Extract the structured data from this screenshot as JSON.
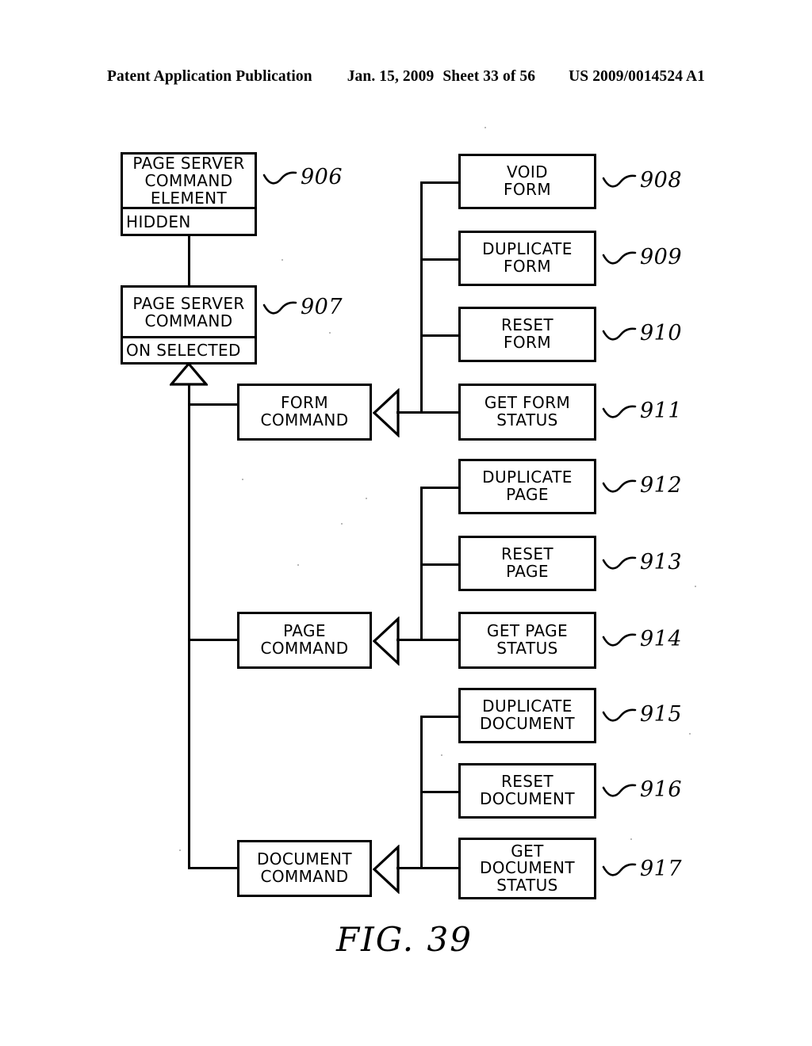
{
  "header": {
    "title": "Patent Application Publication",
    "date": "Jan. 15, 2009",
    "sheet": "Sheet 33 of 56",
    "patent_number": "US 2009/0014524 A1"
  },
  "figure": {
    "caption": "FIG. 39",
    "classes": [
      {
        "id": "page-server-command-element",
        "name": "PAGE SERVER\nCOMMAND\nELEMENT",
        "attribute": "HIDDEN",
        "ref": "906"
      },
      {
        "id": "page-server-command",
        "name": "PAGE SERVER\nCOMMAND",
        "attribute": "ON SELECTED",
        "ref": "907"
      }
    ],
    "command_groups": [
      {
        "id": "form-command",
        "name": "FORM\nCOMMAND",
        "operations": [
          {
            "id": "void-form",
            "name": "VOID\nFORM",
            "ref": "908"
          },
          {
            "id": "duplicate-form",
            "name": "DUPLICATE\nFORM",
            "ref": "909"
          },
          {
            "id": "reset-form",
            "name": "RESET\nFORM",
            "ref": "910"
          },
          {
            "id": "get-form-status",
            "name": "GET FORM\nSTATUS",
            "ref": "911"
          }
        ]
      },
      {
        "id": "page-command",
        "name": "PAGE\nCOMMAND",
        "operations": [
          {
            "id": "duplicate-page",
            "name": "DUPLICATE\nPAGE",
            "ref": "912"
          },
          {
            "id": "reset-page",
            "name": "RESET\nPAGE",
            "ref": "913"
          },
          {
            "id": "get-page-status",
            "name": "GET PAGE\nSTATUS",
            "ref": "914"
          }
        ]
      },
      {
        "id": "document-command",
        "name": "DOCUMENT\nCOMMAND",
        "operations": [
          {
            "id": "duplicate-document",
            "name": "DUPLICATE\nDOCUMENT",
            "ref": "915"
          },
          {
            "id": "reset-document",
            "name": "RESET\nDOCUMENT",
            "ref": "916"
          },
          {
            "id": "get-document-status",
            "name": "GET\nDOCUMENT\nSTATUS",
            "ref": "917"
          }
        ]
      }
    ]
  },
  "colors": {
    "ink": "#000000",
    "paper": "#ffffff"
  }
}
